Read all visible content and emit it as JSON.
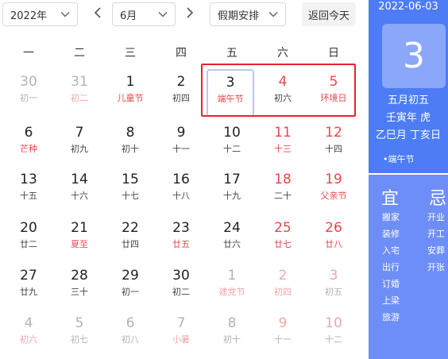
{
  "toolbar": {
    "year_value": "2022年",
    "month_value": "6月",
    "holiday_value": "假期安排",
    "today_label": "返回今天"
  },
  "weekdays": [
    "一",
    "二",
    "三",
    "四",
    "五",
    "六",
    "日"
  ],
  "weeks": [
    [
      {
        "n": "30",
        "l": "初一",
        "t": [
          "other"
        ]
      },
      {
        "n": "31",
        "l": "初二",
        "t": [
          "other",
          "festival"
        ]
      },
      {
        "n": "1",
        "l": "儿童节",
        "t": [
          "festival"
        ]
      },
      {
        "n": "2",
        "l": "初四",
        "t": []
      },
      {
        "n": "3",
        "l": "端午节",
        "t": [
          "selected",
          "festival"
        ]
      },
      {
        "n": "4",
        "l": "初六",
        "t": [
          "weekend"
        ]
      },
      {
        "n": "5",
        "l": "环境日",
        "t": [
          "weekend",
          "festival"
        ]
      }
    ],
    [
      {
        "n": "6",
        "l": "芒种",
        "t": [
          "festival"
        ]
      },
      {
        "n": "7",
        "l": "初九",
        "t": []
      },
      {
        "n": "8",
        "l": "初十",
        "t": []
      },
      {
        "n": "9",
        "l": "十一",
        "t": []
      },
      {
        "n": "10",
        "l": "十二",
        "t": []
      },
      {
        "n": "11",
        "l": "十三",
        "t": [
          "weekend",
          "festival"
        ]
      },
      {
        "n": "12",
        "l": "十四",
        "t": [
          "weekend"
        ]
      }
    ],
    [
      {
        "n": "13",
        "l": "十五",
        "t": []
      },
      {
        "n": "14",
        "l": "十六",
        "t": []
      },
      {
        "n": "15",
        "l": "十七",
        "t": []
      },
      {
        "n": "16",
        "l": "十八",
        "t": []
      },
      {
        "n": "17",
        "l": "十九",
        "t": []
      },
      {
        "n": "18",
        "l": "二十",
        "t": [
          "weekend"
        ]
      },
      {
        "n": "19",
        "l": "父亲节",
        "t": [
          "weekend",
          "festival"
        ]
      }
    ],
    [
      {
        "n": "20",
        "l": "廿二",
        "t": []
      },
      {
        "n": "21",
        "l": "夏至",
        "t": [
          "festival"
        ]
      },
      {
        "n": "22",
        "l": "廿四",
        "t": []
      },
      {
        "n": "23",
        "l": "廿五",
        "t": [
          "festival"
        ]
      },
      {
        "n": "24",
        "l": "廿六",
        "t": []
      },
      {
        "n": "25",
        "l": "廿七",
        "t": [
          "weekend",
          "festival"
        ]
      },
      {
        "n": "26",
        "l": "廿八",
        "t": [
          "weekend",
          "festival"
        ]
      }
    ],
    [
      {
        "n": "27",
        "l": "廿九",
        "t": []
      },
      {
        "n": "28",
        "l": "三十",
        "t": []
      },
      {
        "n": "29",
        "l": "初一",
        "t": []
      },
      {
        "n": "30",
        "l": "初二",
        "t": []
      },
      {
        "n": "1",
        "l": "建党节",
        "t": [
          "other",
          "festival"
        ]
      },
      {
        "n": "2",
        "l": "初四",
        "t": [
          "other",
          "weekend",
          "festival"
        ]
      },
      {
        "n": "3",
        "l": "初五",
        "t": [
          "other",
          "weekend"
        ]
      }
    ],
    [
      {
        "n": "4",
        "l": "初六",
        "t": [
          "other",
          "festival"
        ]
      },
      {
        "n": "5",
        "l": "初七",
        "t": [
          "other"
        ]
      },
      {
        "n": "6",
        "l": "初八",
        "t": [
          "other"
        ]
      },
      {
        "n": "7",
        "l": "小暑",
        "t": [
          "other",
          "festival"
        ]
      },
      {
        "n": "8",
        "l": "初十",
        "t": [
          "other"
        ]
      },
      {
        "n": "9",
        "l": "十一",
        "t": [
          "other",
          "weekend"
        ]
      },
      {
        "n": "10",
        "l": "十二",
        "t": [
          "other",
          "weekend"
        ]
      }
    ]
  ],
  "panel": {
    "date": "2022-06-03",
    "day": "3",
    "lunar_date": "五月初五",
    "ganzhi_year": "壬寅年 虎",
    "ganzhi_month_day": "乙巳月 丁亥日",
    "festival": "•端午节",
    "yi_title": "宜",
    "ji_title": "忌",
    "yi": [
      "搬家",
      "装修",
      "入宅",
      "出行",
      "订婚",
      "上梁",
      "旅游"
    ],
    "ji": [
      "开业",
      "开工",
      "安葬",
      "开张"
    ]
  },
  "colors": {
    "accent_blue": "#4d7cf5",
    "panel_light_blue": "#6e8ef7",
    "day_tile": "#8aa7fa",
    "red": "#e8474b",
    "holiday_outline": "#e8222b"
  }
}
